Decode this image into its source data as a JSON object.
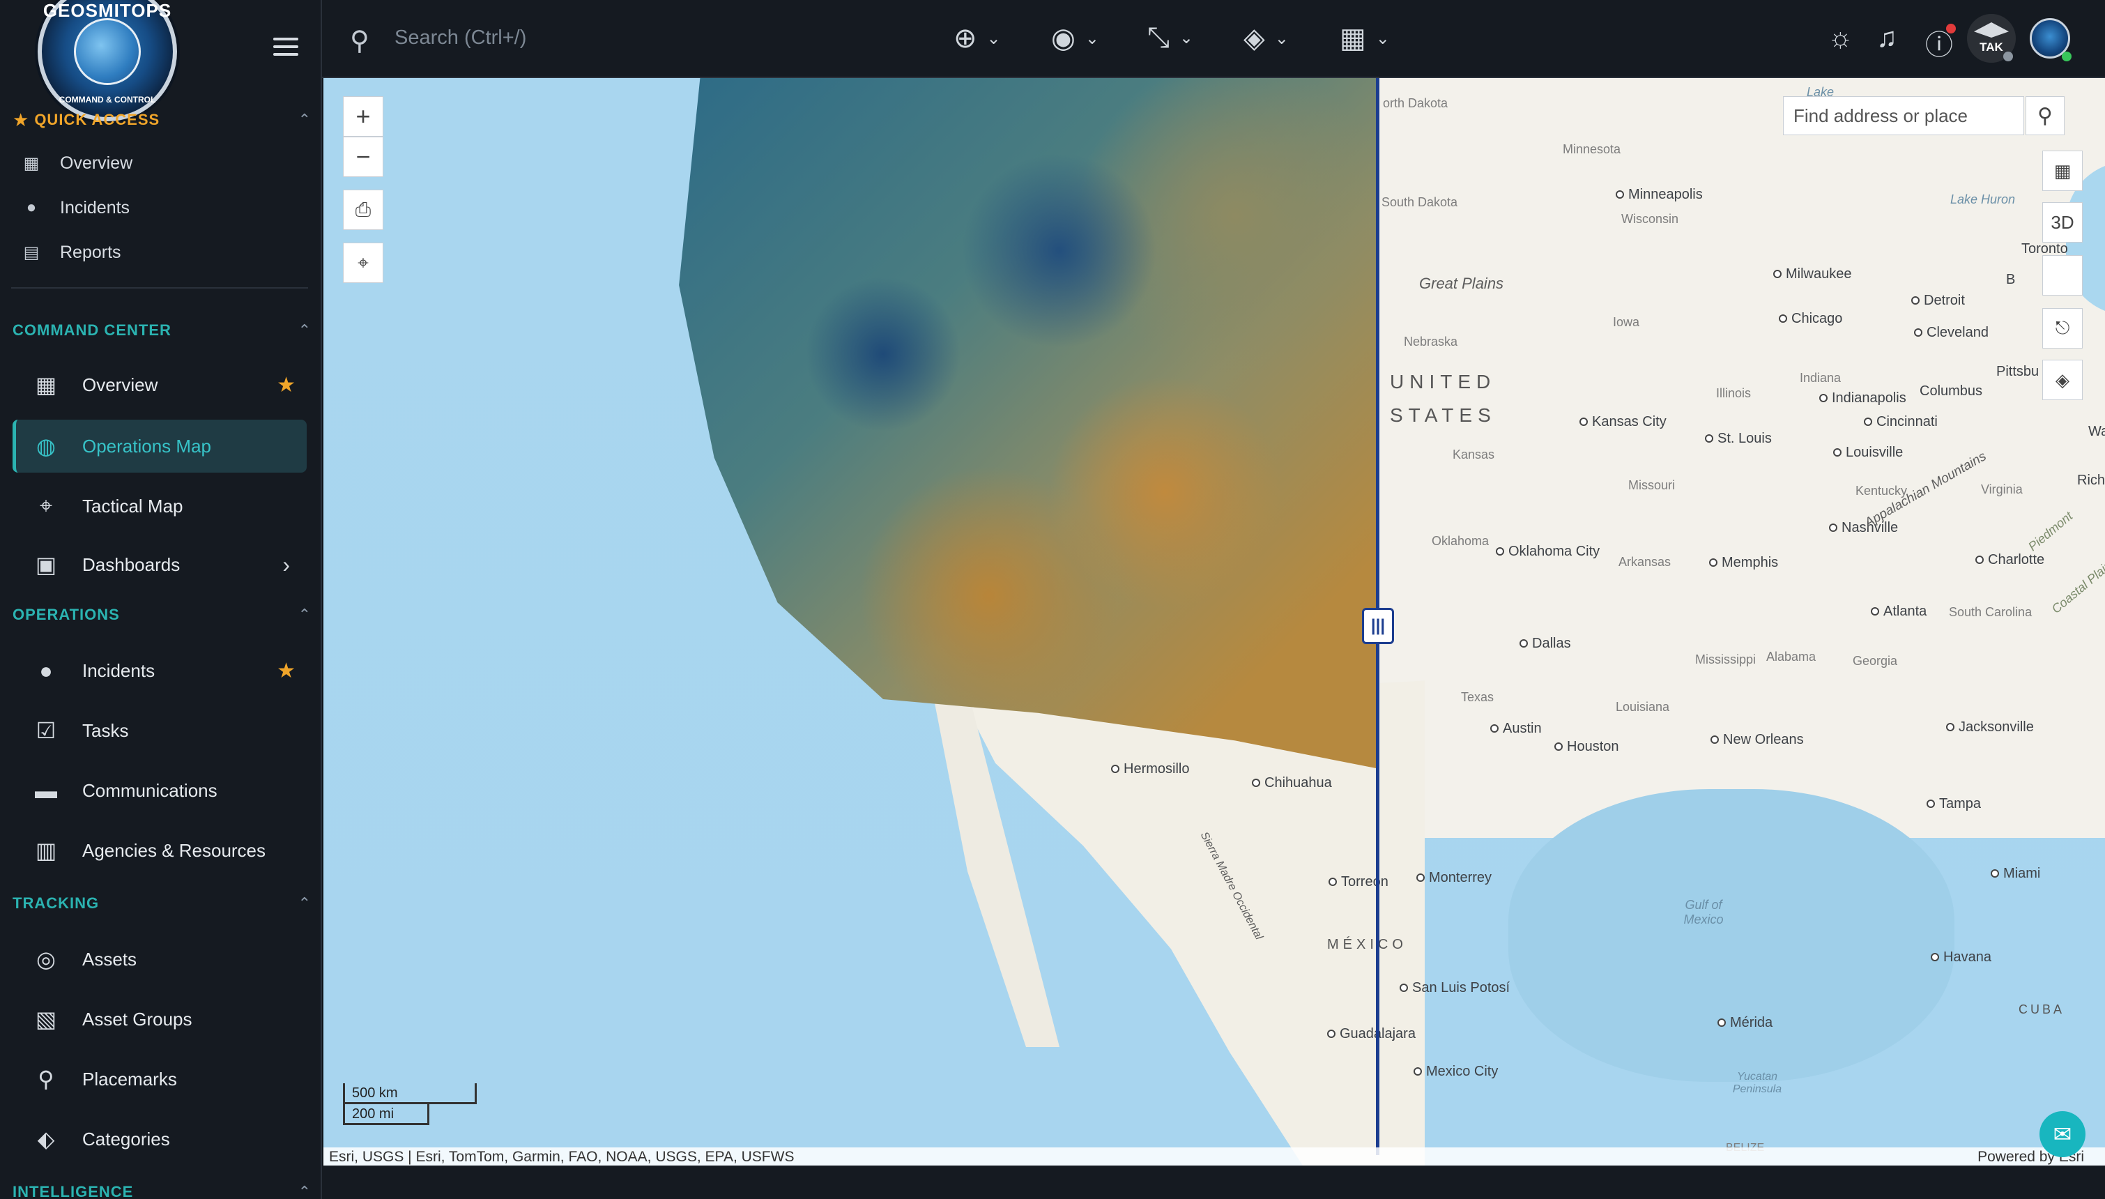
{
  "sidebar": {
    "logo_text": "GEOSMITOPS",
    "logo_sub": "COMMAND & CONTROL",
    "quick_access": {
      "title": "QUICK ACCESS",
      "items": [
        {
          "label": "Overview",
          "icon": "grid-icon"
        },
        {
          "label": "Incidents",
          "icon": "alert-icon"
        },
        {
          "label": "Reports",
          "icon": "document-icon"
        }
      ]
    },
    "command_center": {
      "title": "COMMAND CENTER",
      "items": [
        {
          "label": "Overview",
          "icon": "dashboard-icon",
          "starred": true
        },
        {
          "label": "Operations Map",
          "icon": "globe-icon",
          "active": true
        },
        {
          "label": "Tactical Map",
          "icon": "location-pin-icon"
        },
        {
          "label": "Dashboards",
          "icon": "monitor-icon",
          "has_submenu": true
        }
      ]
    },
    "operations": {
      "title": "OPERATIONS",
      "items": [
        {
          "label": "Incidents",
          "icon": "alert-icon",
          "starred": true
        },
        {
          "label": "Tasks",
          "icon": "clipboard-check-icon"
        },
        {
          "label": "Communications",
          "icon": "message-icon"
        },
        {
          "label": "Agencies & Resources",
          "icon": "building-icon"
        }
      ]
    },
    "tracking": {
      "title": "TRACKING",
      "items": [
        {
          "label": "Assets",
          "icon": "crosshair-icon"
        },
        {
          "label": "Asset Groups",
          "icon": "group-icon"
        },
        {
          "label": "Placemarks",
          "icon": "pin-icon"
        },
        {
          "label": "Categories",
          "icon": "tag-icon"
        }
      ]
    },
    "intelligence": {
      "title": "INTELLIGENCE"
    }
  },
  "topbar": {
    "search_placeholder": "Search (Ctrl+/)",
    "tak_label": "TAK"
  },
  "map": {
    "find_placeholder": "Find address or place",
    "btn_3d": "3D",
    "scale": {
      "km": "500 km",
      "mi": "200 mi"
    },
    "attribution": "Esri, USGS | Esri, TomTom, Garmin, FAO, NOAA, USGS, EPA, USFWS",
    "powered": "Powered by Esri",
    "labels": {
      "north_dakota": "orth Dakota",
      "south_dakota": "South Dakota",
      "minnesota": "Minnesota",
      "minneapolis": "Minneapolis",
      "wisconsin": "Wisconsin",
      "great_plains": "Great Plains",
      "nebraska": "Nebraska",
      "iowa": "Iowa",
      "milwaukee": "Milwaukee",
      "chicago": "Chicago",
      "detroit": "Detroit",
      "toronto": "Toronto",
      "lake_huron": "Lake Huron",
      "lake": "Lake",
      "cleveland": "Cleveland",
      "pittsburgh": "Pittsbu",
      "united": "UNITED",
      "states": "STATES",
      "kansas": "Kansas",
      "kansas_city": "Kansas City",
      "illinois": "Illinois",
      "indiana": "Indiana",
      "indianapolis": "Indianapolis",
      "columbus": "Columbus",
      "cincinnati": "Cincinnati",
      "st_louis": "St. Louis",
      "louisville": "Louisville",
      "missouri": "Missouri",
      "kentucky": "Kentucky",
      "virginia": "Virginia",
      "oklahoma": "Oklahoma",
      "oklahoma_city": "Oklahoma City",
      "arkansas": "Arkansas",
      "nashville": "Nashville",
      "memphis": "Memphis",
      "charlotte": "Charlotte",
      "appalachian": "Appalachian Mountains",
      "piedmont": "Piedmont",
      "coastal_plain": "Coastal Plain",
      "atlanta": "Atlanta",
      "south_carolina": "South Carolina",
      "mississippi": "Mississippi",
      "alabama": "Alabama",
      "georgia": "Georgia",
      "dallas": "Dallas",
      "texas": "Texas",
      "louisiana": "Louisiana",
      "austin": "Austin",
      "houston": "Houston",
      "new_orleans": "New Orleans",
      "jacksonville": "Jacksonville",
      "tampa": "Tampa",
      "miami": "Miami",
      "gulf_of_mexico": "Gulf of Mexico",
      "hermosillo": "Hermosillo",
      "chihuahua": "Chihuahua",
      "sierra_madre": "Sierra Madre Occidental",
      "torreon": "Torreon",
      "monterrey": "Monterrey",
      "mexico": "MÉXICO",
      "san_luis_potosi": "San Luis Potosí",
      "guadalajara": "Guadalajara",
      "mexico_city": "Mexico City",
      "havana": "Havana",
      "merida": "Mérida",
      "cuba": "CUBA",
      "yucatan": "Yucatan Peninsula",
      "belize": "BELIZE",
      "richmond": "Rich",
      "wa": "Wa",
      "b": "B"
    }
  }
}
